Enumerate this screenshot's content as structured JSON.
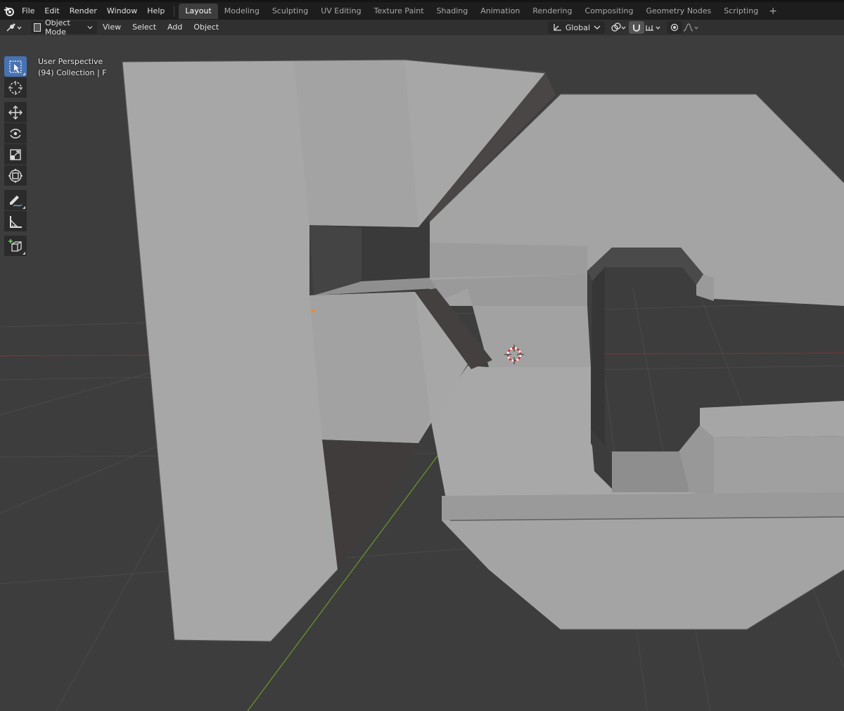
{
  "menu": {
    "items": [
      "File",
      "Edit",
      "Render",
      "Window",
      "Help"
    ]
  },
  "workspaces": {
    "tabs": [
      "Layout",
      "Modeling",
      "Sculpting",
      "UV Editing",
      "Texture Paint",
      "Shading",
      "Animation",
      "Rendering",
      "Compositing",
      "Geometry Nodes",
      "Scripting"
    ],
    "active": "Layout",
    "add_symbol": "+"
  },
  "header": {
    "mode": "Object Mode",
    "menus": [
      "View",
      "Select",
      "Add",
      "Object"
    ],
    "transform_orientation": "Global"
  },
  "viewport": {
    "view_name": "User Perspective",
    "collection_info": "(94) Collection | F"
  },
  "toolbar": {
    "tools": [
      "select-box",
      "cursor",
      "move",
      "rotate",
      "scale",
      "transform",
      "annotate",
      "measure",
      "add-cube"
    ],
    "active": "select-box"
  },
  "colors": {
    "accent": "#4772b3",
    "topbar": "#1d1d1d",
    "header": "#303030",
    "viewport_bg": "#3d3d3d",
    "grid": "#4a4a4a",
    "x_axis": "#8a3a3a",
    "y_axis": "#6a9a2a",
    "mesh": "#a4a4a4"
  }
}
